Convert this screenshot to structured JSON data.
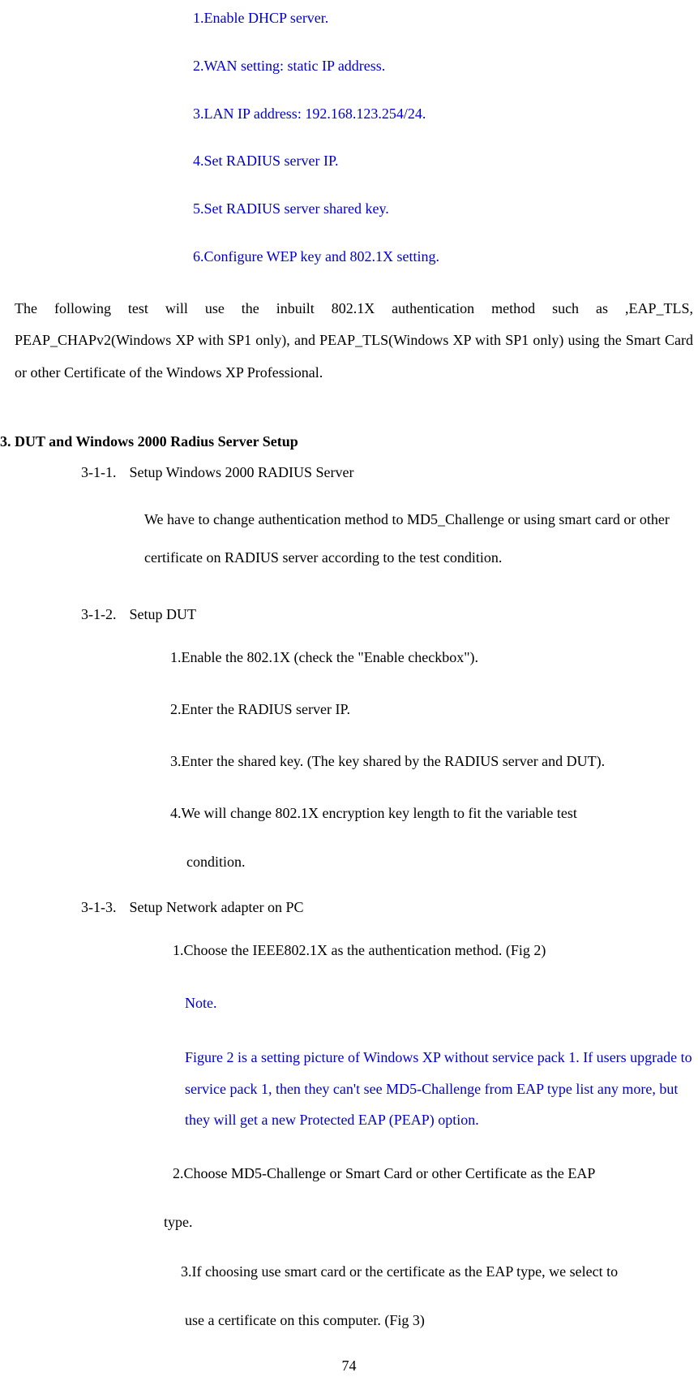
{
  "blueSteps": {
    "s1": "1.Enable DHCP server.",
    "s2": "2.WAN setting: static IP address.",
    "s3": "3.LAN IP address: 192.168.123.254/24.",
    "s4": "4.Set RADIUS server IP.",
    "s5": "5.Set RADIUS server shared key.",
    "s6": "6.Configure WEP key and 802.1X setting."
  },
  "paragraph": "The following test will use the inbuilt 802.1X authentication method such as ,EAP_TLS, PEAP_CHAPv2(Windows XP with SP1 only), and PEAP_TLS(Windows XP with SP1 only) using the Smart Card or other Certificate of the Windows XP Professional.",
  "sectionHeader": "3. DUT and Windows 2000 Radius Server Setup",
  "item1": {
    "label": "3-1-1.",
    "title": "Setup Windows 2000 RADIUS Server",
    "desc": "We have to change authentication method to MD5_Challenge or using smart card or other certificate on RADIUS server according to the test condition."
  },
  "item2": {
    "label": "3-1-2.",
    "title": "Setup DUT",
    "s1": "1.Enable the 802.1X (check the \"Enable checkbox\").",
    "s2": "2.Enter the RADIUS server IP.",
    "s3": "3.Enter the shared key. (The key shared by the RADIUS server and DUT).",
    "s4": "4.We will change 802.1X encryption key length to fit the variable test",
    "s4cont": "condition."
  },
  "item3": {
    "label": "3-1-3.",
    "title": "Setup Network adapter on PC",
    "s1": "1.Choose the IEEE802.1X as the authentication method. (Fig 2)",
    "noteLabel": "Note.",
    "noteText": "Figure 2 is a setting picture of Windows XP without service pack 1. If users upgrade to service pack 1, then they can't see MD5-Challenge from EAP type list any more, but they will get a new Protected EAP (PEAP) option.",
    "s2": "2.Choose MD5-Challenge or Smart Card or other Certificate as the EAP",
    "s2cont": "type.",
    "s3": "3.If choosing use smart card or the certificate as the EAP type, we select to",
    "s3cont": "use a certificate on this computer. (Fig 3)"
  },
  "pageNumber": "74"
}
